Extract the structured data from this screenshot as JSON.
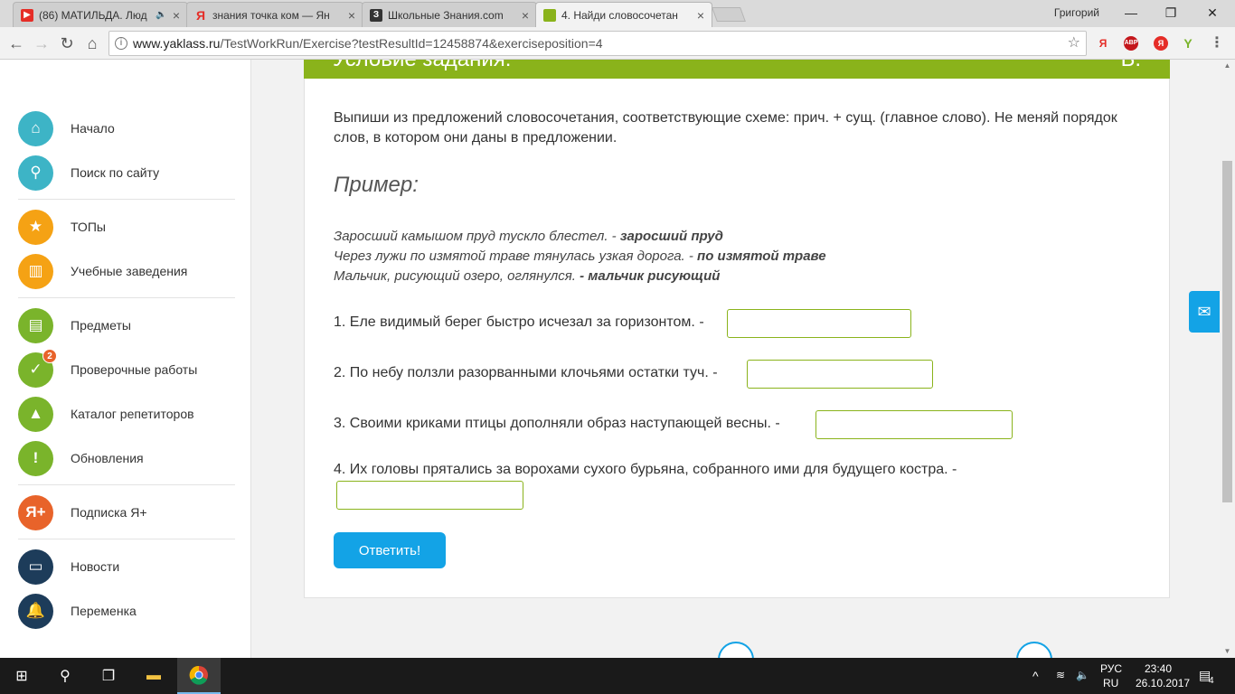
{
  "browser": {
    "tabs": [
      {
        "title": "(86) МАТИЛЬДА. Люд",
        "favicon": "youtube-icon",
        "color": "#e52d27"
      },
      {
        "title": "знания точка ком — Ян",
        "favicon": "yandex-icon",
        "color": "#e52d27"
      },
      {
        "title": "Школьные Знания.com",
        "favicon": "znanija-icon",
        "color": "#333333"
      },
      {
        "title": "4. Найди словосочетан",
        "favicon": "yaklass-icon",
        "color": "#8ab31b"
      }
    ],
    "user": "Григорий",
    "url_host": "www.yaklass.ru",
    "url_path": "/TestWorkRun/Exercise?testResultId=12458874&exerciseposition=4"
  },
  "sidebar": {
    "items": [
      {
        "label": "Начало",
        "icon": "home-icon",
        "color": "#3db4c6"
      },
      {
        "label": "Поиск по сайту",
        "icon": "search-icon",
        "color": "#3db4c6"
      },
      {
        "label": "ТОПы",
        "icon": "star-icon",
        "color": "#f5a214"
      },
      {
        "label": "Учебные заведения",
        "icon": "building-icon",
        "color": "#f5a214"
      },
      {
        "label": "Предметы",
        "icon": "book-icon",
        "color": "#7ab42b"
      },
      {
        "label": "Проверочные работы",
        "icon": "check-icon",
        "color": "#7ab42b",
        "badge": "2"
      },
      {
        "label": "Каталог репетиторов",
        "icon": "graduation-cap-icon",
        "color": "#7ab42b"
      },
      {
        "label": "Обновления",
        "icon": "exclamation-icon",
        "color": "#7ab42b"
      },
      {
        "label": "Подписка Я+",
        "icon": "yaplus-icon",
        "color": "#e8632a"
      },
      {
        "label": "Новости",
        "icon": "news-icon",
        "color": "#1d3c5a"
      },
      {
        "label": "Переменка",
        "icon": "bell-icon",
        "color": "#1d3c5a"
      }
    ]
  },
  "exercise": {
    "header_title": "Условие задания:",
    "header_right": "Б.",
    "task": "Выпиши из предложений словосочетания, соответствующие схеме: прич. + сущ. (главное слово). Не меняй порядок слов, в котором они даны в предложении.",
    "example_heading": "Пример:",
    "examples": [
      {
        "text": "Заросший камышом пруд тускло блестел. - ",
        "answer": "заросший пруд"
      },
      {
        "text": "Через лужи по измятой траве тянулась узкая дорога. - ",
        "answer": "по измятой траве"
      },
      {
        "text": "Мальчик, рисующий озеро, оглянулся. ",
        "answer": "- мальчик рисующий"
      }
    ],
    "questions": [
      "1. Еле видимый берег быстро исчезал за горизонтом. -",
      "2. По небу ползли разорванными клочьями остатки туч. -",
      "3. Своими криками птицы дополняли образ наступающей весны.  -",
      "4. Их головы прятались за ворохами сухого бурьяна, собранного ими для будущего костра. -"
    ],
    "submit_label": "Ответить!"
  },
  "taskbar": {
    "lang_top": "РУС",
    "lang_bottom": "RU",
    "time": "23:40",
    "date": "26.10.2017",
    "notifications": "4"
  }
}
